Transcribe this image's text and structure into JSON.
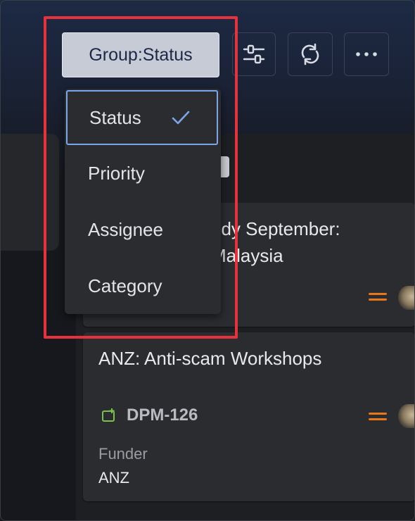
{
  "toolbar": {
    "group_button_label": "Group:Status",
    "filter_icon": "sliders-icon",
    "refresh_icon": "refresh-icon",
    "more_icon": "more-horizontal-icon"
  },
  "group_menu": {
    "items": [
      {
        "label": "Status",
        "selected": true
      },
      {
        "label": "Priority",
        "selected": false
      },
      {
        "label": "Assignee",
        "selected": false
      },
      {
        "label": "Category",
        "selected": false
      }
    ],
    "check_icon": "check-icon"
  },
  "cards": [
    {
      "title_line1": "udy September:",
      "title_line2": "Malaysia",
      "priority_icon": "priority-medium-icon"
    },
    {
      "title": "ANZ: Anti-scam Workshops",
      "issue_key": "DPM-126",
      "issue_type_icon": "epic-icon",
      "priority_icon": "priority-medium-icon",
      "field_label": "Funder",
      "field_value": "ANZ"
    }
  ],
  "colors": {
    "priority": "#e8761b",
    "selection_border": "#7aa7ea",
    "annotation_box": "#e5323d",
    "issue_type_icon": "#7bc24b"
  }
}
